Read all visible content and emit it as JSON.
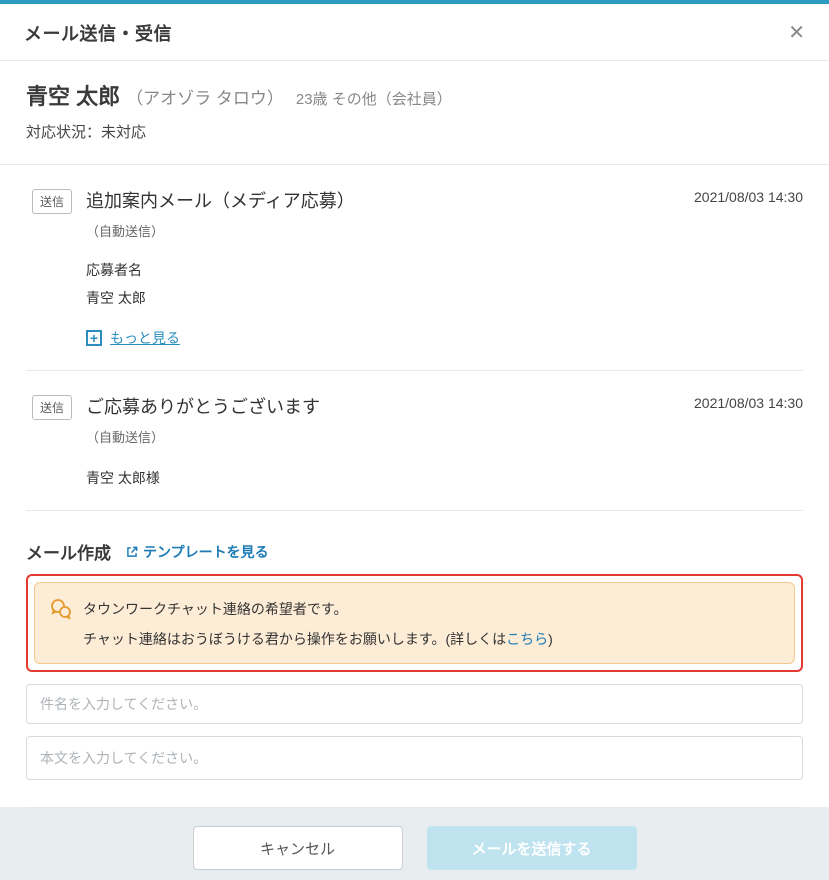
{
  "header": {
    "title": "メール送信・受信"
  },
  "person": {
    "name": "青空 太郎",
    "kana": "（アオゾラ タロウ）",
    "age_etc": "23歳 その他（会社員）"
  },
  "status": {
    "label": "対応状況：",
    "value": "未対応"
  },
  "badges": {
    "sent": "送信"
  },
  "messages": [
    {
      "subject": "追加案内メール（メディア応募）",
      "auto": "（自動送信）",
      "date": "2021/08/03 14:30",
      "field_label": "応募者名",
      "field_value": "青空 太郎",
      "more": "もっと見る"
    },
    {
      "subject": "ご応募ありがとうございます",
      "auto": "（自動送信）",
      "date": "2021/08/03 14:30",
      "line1": "青空 太郎様"
    }
  ],
  "compose": {
    "title": "メール作成",
    "template_link": "テンプレートを見る",
    "notice_line1": "タウンワークチャット連絡の希望者です。",
    "notice_line2a": "チャット連絡はおうぼうける君から操作をお願いします。(詳しくは",
    "notice_link": "こちら",
    "notice_line2b": ")",
    "subject_placeholder": "件名を入力してください。",
    "body_placeholder": "本文を入力してください。"
  },
  "footer": {
    "cancel": "キャンセル",
    "send": "メールを送信する"
  }
}
